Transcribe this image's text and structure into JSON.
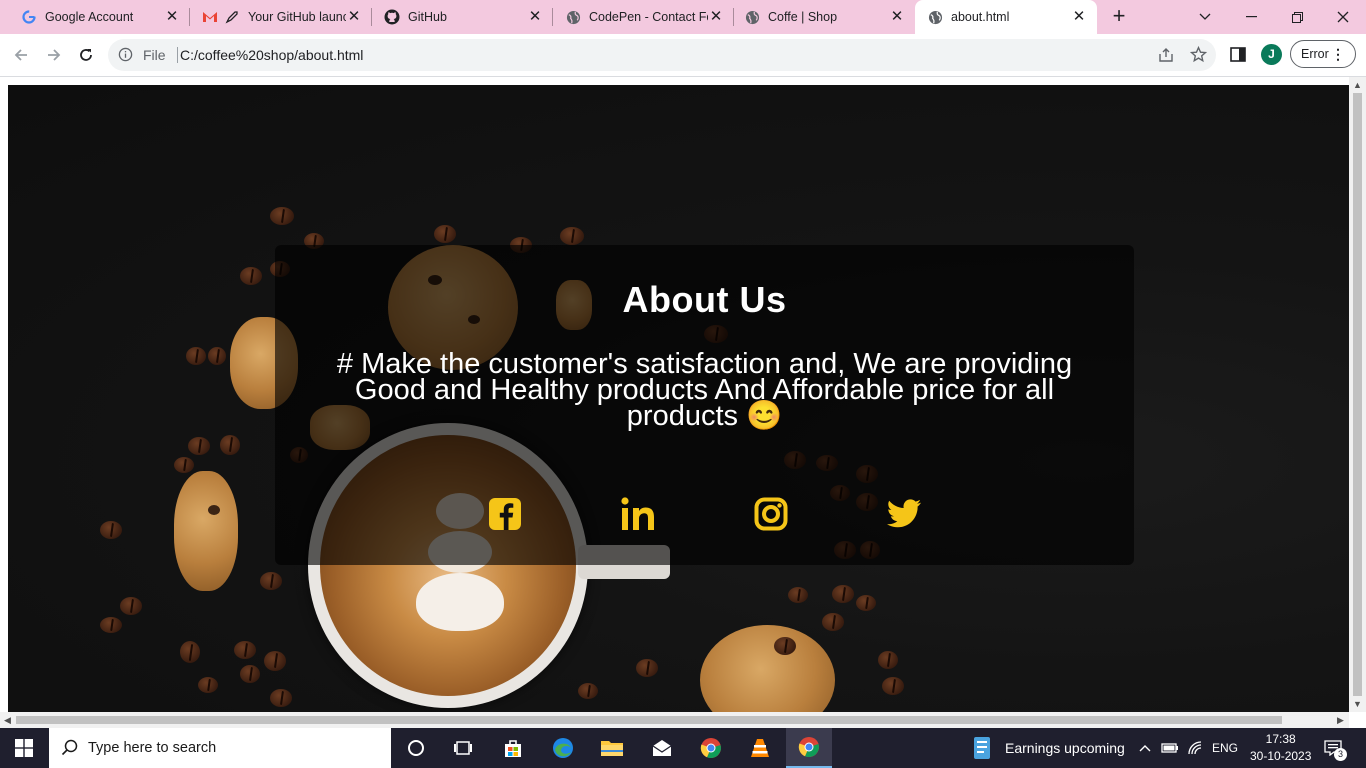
{
  "tabs": [
    {
      "title": "Google Account",
      "icon": "google-icon"
    },
    {
      "title": "Your GitHub launc",
      "icon": "gmail-icon"
    },
    {
      "title": "GitHub",
      "icon": "github-icon"
    },
    {
      "title": "CodePen - Contact Fo",
      "icon": "globe-icon"
    },
    {
      "title": "Coffe | Shop",
      "icon": "globe-icon"
    },
    {
      "title": "about.html",
      "icon": "globe-icon"
    }
  ],
  "address": {
    "scheme_label": "File",
    "url": "C:/coffee%20shop/about.html"
  },
  "profile": {
    "initial": "J"
  },
  "error_button": {
    "label": "Error"
  },
  "page": {
    "heading": "About Us",
    "paragraph": "# Make the customer's satisfaction and, We are providing Good and Healthy products And Affordable price for all products 😊",
    "social": [
      "facebook-icon",
      "linkedin-icon",
      "instagram-icon",
      "twitter-icon"
    ],
    "accent_color": "#f5c518"
  },
  "taskbar": {
    "search_placeholder": "Type here to search",
    "news": "Earnings upcoming",
    "language": "ENG",
    "time": "17:38",
    "date": "30-10-2023",
    "notification_count": "3"
  }
}
